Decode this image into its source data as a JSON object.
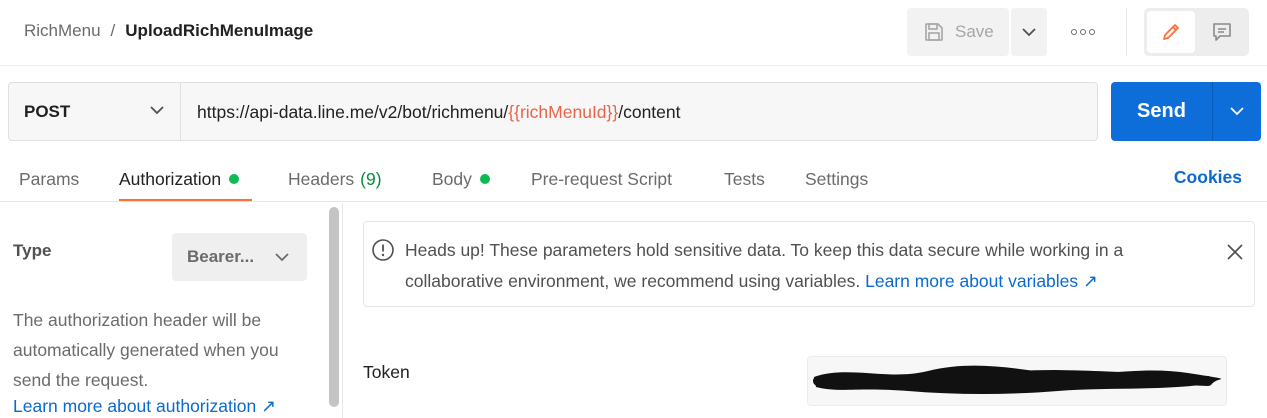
{
  "breadcrumb": {
    "parent": "RichMenu",
    "separator": "/",
    "current": "UploadRichMenuImage"
  },
  "toolbar": {
    "save_label": "Save"
  },
  "request": {
    "method": "POST",
    "url_prefix": "https://api-data.line.me/v2/bot/richmenu/",
    "url_variable": "{{richMenuId}}",
    "url_suffix": "/content",
    "send_label": "Send"
  },
  "tabs": [
    {
      "label": "Params"
    },
    {
      "label": "Authorization",
      "active": true,
      "dot": true
    },
    {
      "label": "Headers",
      "count": "(9)"
    },
    {
      "label": "Body",
      "dot": true
    },
    {
      "label": "Pre-request Script"
    },
    {
      "label": "Tests"
    },
    {
      "label": "Settings"
    }
  ],
  "cookies_label": "Cookies",
  "auth": {
    "type_label": "Type",
    "type_value": "Bearer...",
    "description": "The authorization header will be automatically generated when you send the request.",
    "learn_more": "Learn more about authorization ↗"
  },
  "alert": {
    "text": "Heads up! These parameters hold sensitive data. To keep this data secure while working in a collaborative environment, we recommend using variables.",
    "link": "Learn more about variables ↗"
  },
  "token": {
    "label": "Token"
  },
  "colors": {
    "accent": "#ff6c37",
    "send": "#0e6ed9",
    "link": "#0b69cf",
    "variable": "#e8654a",
    "dot": "#0cbb52"
  }
}
